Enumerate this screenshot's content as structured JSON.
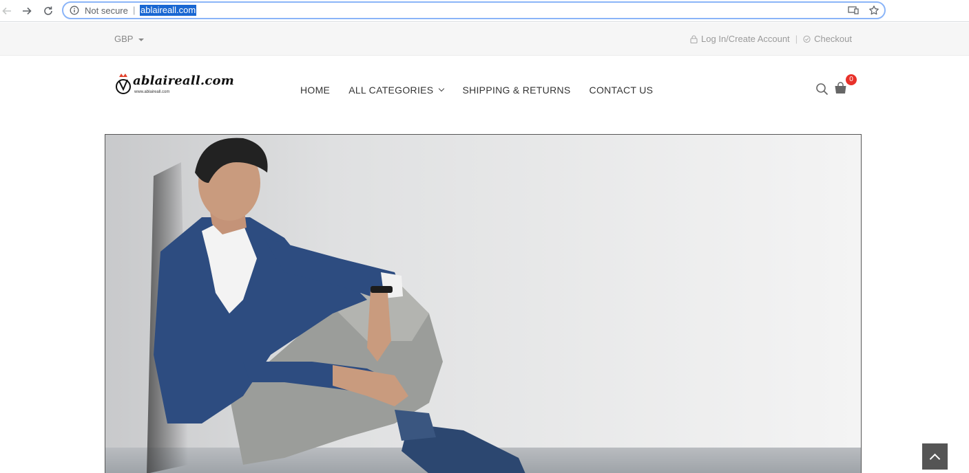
{
  "browser": {
    "security_label": "Not secure",
    "separator": "|",
    "url": "ablaireall.com"
  },
  "topbar": {
    "currency": "GBP",
    "login_label": "Log In/Create Account",
    "divider": "|",
    "checkout_label": "Checkout"
  },
  "logo": {
    "text": "ablaireall.com",
    "subtext": "www.ablaireall.com"
  },
  "nav": {
    "items": [
      {
        "label": "HOME"
      },
      {
        "label": "ALL CATEGORIES"
      },
      {
        "label": "SHIPPING & RETURNS"
      },
      {
        "label": "CONTACT US"
      }
    ]
  },
  "cart": {
    "count": "0"
  },
  "colors": {
    "url_highlight": "#1967d2",
    "cart_badge": "#e8312a",
    "back_to_top": "#555555"
  }
}
